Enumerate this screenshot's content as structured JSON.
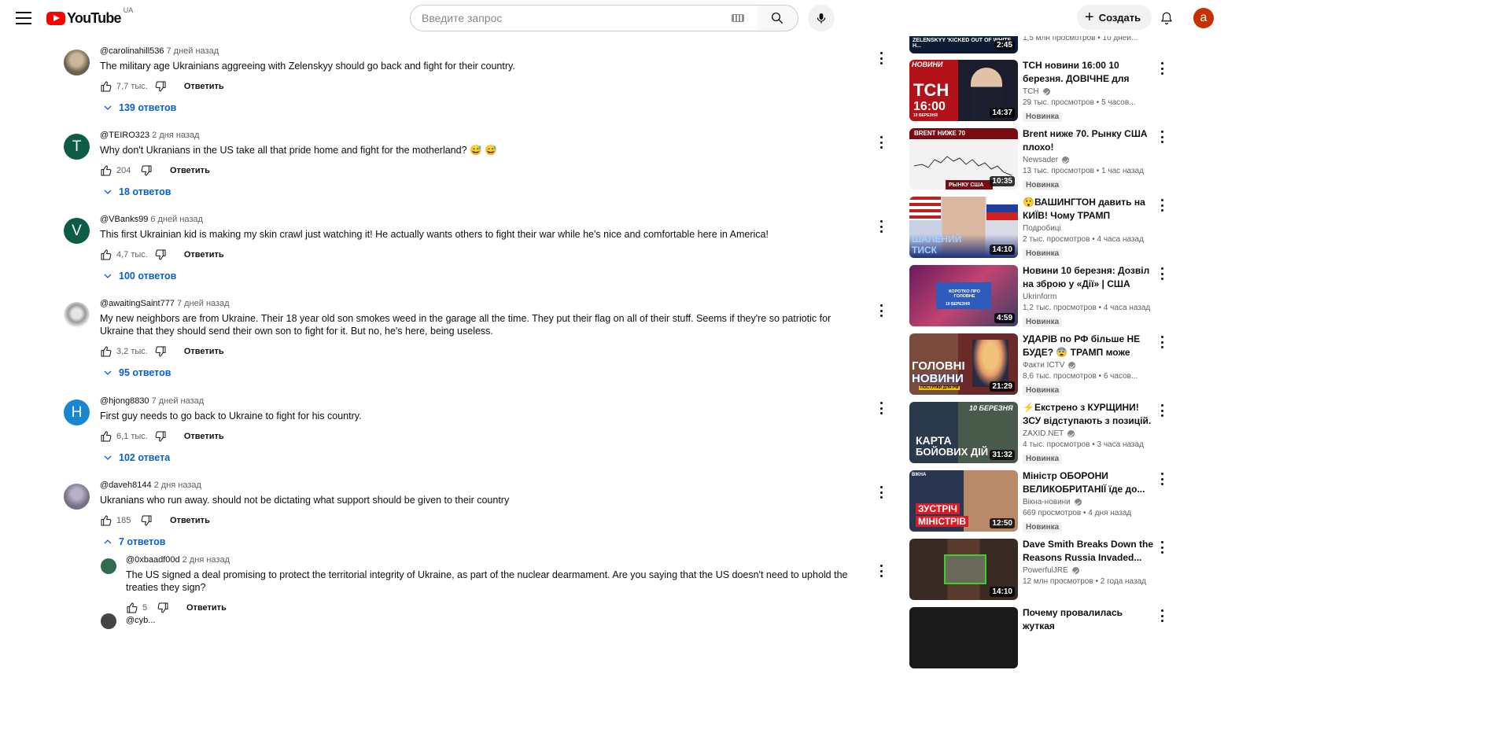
{
  "header": {
    "logo_text": "YouTube",
    "country": "UA",
    "search_placeholder": "Введите запрос",
    "create_label": "Создать",
    "avatar_letter": "a"
  },
  "comments": [
    {
      "author": "@carolinahill536",
      "time": "7 дней назад",
      "text": "The military age Ukrainians aggreeing with Zelenskyy should go back and fight for their country.",
      "likes": "7,7 тыс.",
      "reply_label": "Ответить",
      "replies": "139 ответов"
    },
    {
      "author": "@TEIRO323",
      "time": "2 дня назад",
      "text": "Why don't Ukranians in the US take all that pride home and fight for the motherland? 😅 😅",
      "likes": "204",
      "reply_label": "Ответить",
      "replies": "18 ответов",
      "avatar_letter": "T"
    },
    {
      "author": "@VBanks99",
      "time": "6 дней назад",
      "text": "This first Ukrainian kid is making my skin crawl just watching it! He actually wants others to fight their war while he's nice and comfortable here in America!",
      "likes": "4,7 тыс.",
      "reply_label": "Ответить",
      "replies": "100 ответов",
      "avatar_letter": "V"
    },
    {
      "author": "@awaitingSaint777",
      "time": "7 дней назад",
      "text": "My new neighbors are from Ukraine. Their 18 year old son smokes weed in the garage all the time. They put their flag on all of their stuff. Seems if they're so patriotic for Ukraine that they should send their own son to fight for it. But no, he's here, being useless.",
      "likes": "3,2 тыс.",
      "reply_label": "Ответить",
      "replies": "95 ответов"
    },
    {
      "author": "@hjong8830",
      "time": "7 дней назад",
      "text": "First guy needs to go back to Ukraine to fight for his country.",
      "likes": "6,1 тыс.",
      "reply_label": "Ответить",
      "replies": "102 ответа",
      "avatar_letter": "H"
    },
    {
      "author": "@daveh8144",
      "time": "2 дня назад",
      "text": "Ukranians who run away. should not be dictating what support should be given to their country",
      "likes": "185",
      "reply_label": "Ответить",
      "replies": "7 ответов"
    }
  ],
  "reply": {
    "author": "@0xbaadf00d",
    "time": "2 дня назад",
    "text": "The US signed a deal promising to protect the territorial integrity of Ukraine, as part of the nuclear dearmament. Are you saying that the US doesn't need to uphold the treaties they sign?",
    "likes": "5",
    "reply_label": "Ответить"
  },
  "next_reply": {
    "author": "@cyb..."
  },
  "sidebar": {
    "top_partial": {
      "stats_views": "1,5 млн просмотров",
      "stats_time": "10 дней...",
      "duration": "2:45",
      "thumb_text": "ZELENSKYY 'KICKED OUT OF WHITE H..."
    },
    "videos": [
      {
        "title": "ТСН новини 16:00 10 березня. ДОВІЧНЕ для ЗІНЧЕНКА!? У...",
        "channel": "ТСН",
        "verified": true,
        "views": "29 тыс. просмотров",
        "time": "5 часов...",
        "badge": "Новинка",
        "duration": "14:37",
        "thumb_label": "ТСН",
        "thumb_sub": "16:00",
        "thumb_tag": "НОВИНИ",
        "thumb_date": "10 БЕРЕЗНЯ"
      },
      {
        "title": "Brent ниже 70. Рынку США плохо!",
        "channel": "Newsader",
        "verified": true,
        "views": "13 тыс. просмотров",
        "time": "1 час назад",
        "badge": "Новинка",
        "duration": "10:35",
        "thumb_label": "BRENT НИЖЕ 70",
        "thumb_sub": "РЫНКУ США"
      },
      {
        "title": "😲ВАШИНГТОН давить на КИЇВ! Чому ТРАМП насильно...",
        "channel": "Подробиці",
        "verified": false,
        "views": "2 тыс. просмотров",
        "time": "4 часа назад",
        "badge": "Новинка",
        "duration": "14:10",
        "thumb_label": "ШАЛЕНИЙ",
        "thumb_sub": "ТИСК"
      },
      {
        "title": "Новини 10 березня: Дозвіл на зброю у «Дії» | США зупинил...",
        "channel": "Ukrinform",
        "verified": false,
        "views": "1,2 тыс. просмотров",
        "time": "4 часа назад",
        "badge": "Новинка",
        "duration": "4:59",
        "thumb_label": "КОРОТКО ПРО ГОЛОВНЕ",
        "thumb_sub": "10 БЕРЕЗНЯ"
      },
      {
        "title": "УДАРІВ по РФ більше НЕ БУДЕ? 😨 ТРАМП може ЗНЯТ...",
        "channel": "Факти ICTV",
        "verified": true,
        "views": "8,6 тыс. просмотров",
        "time": "6 часов...",
        "badge": "Новинка",
        "duration": "21:29",
        "thumb_label": "ГОЛОВНІ",
        "thumb_sub": "НОВИНИ",
        "thumb_tag": "ПОСТУПКИ ДЛЯ РФ"
      },
      {
        "title": "⚡Екстрено з КУРЩИНИ! ЗСУ відступають з позицій. Путін...",
        "channel": "ZAXID.NET",
        "verified": true,
        "views": "4 тыс. просмотров",
        "time": "3 часа назад",
        "badge": "Новинка",
        "duration": "31:32",
        "thumb_label": "КАРТА",
        "thumb_sub": "БОЙОВИХ ДІЙ",
        "thumb_tag": "10 БЕРЕЗНЯ"
      },
      {
        "title": "Міністр ОБОРОНИ ВЕЛИКОБРИТАНІЇ їде до...",
        "channel": "Вікна-новини",
        "verified": true,
        "views": "669 просмотров",
        "time": "4 дня назад",
        "badge": "Новинка",
        "duration": "12:50",
        "thumb_label": "ЗУСТРІЧ",
        "thumb_sub": "МІНІСТРІВ",
        "thumb_tag": "ВІКНА"
      },
      {
        "title": "Dave Smith Breaks Down the Reasons Russia Invaded...",
        "channel": "PowerfulJRE",
        "verified": true,
        "views": "12 млн просмотров",
        "time": "2 года назад",
        "badge": "",
        "duration": "14:10"
      },
      {
        "title": "Почему провалилась жуткая",
        "channel": "",
        "verified": false,
        "views": "",
        "time": "",
        "badge": "",
        "duration": ""
      }
    ]
  },
  "colors": {
    "accent_blue": "#065fd4",
    "youtube_red": "#ff0000",
    "avatar_orange": "#c83000"
  }
}
